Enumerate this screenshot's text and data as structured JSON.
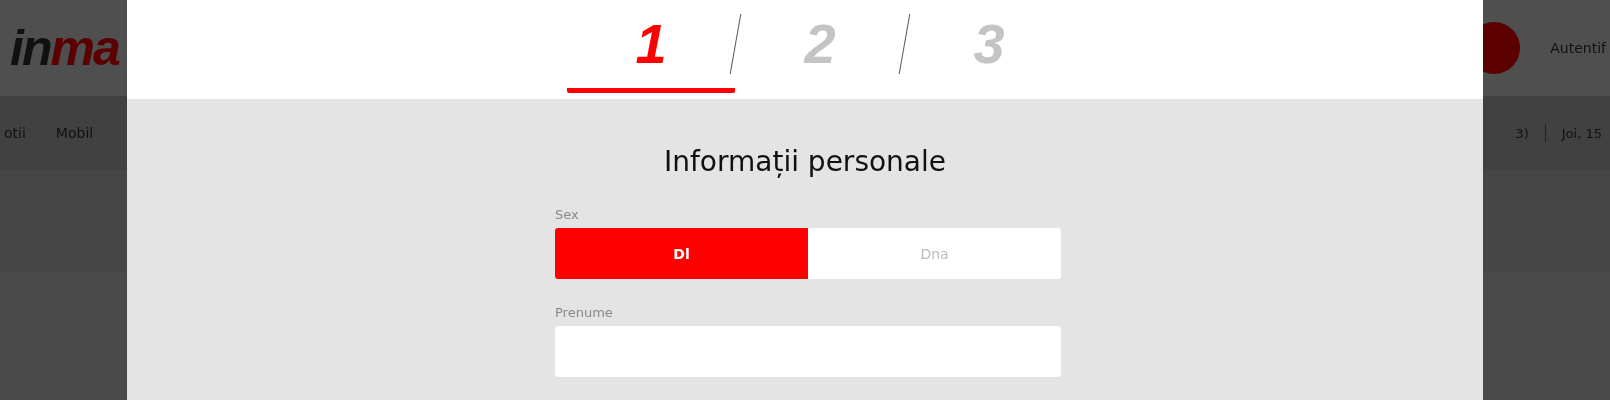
{
  "header": {
    "logo": {
      "part_1": "in",
      "part_2": "ma"
    },
    "login_link": "Autentif"
  },
  "nav": {
    "items": [
      "otii",
      "Mobil"
    ],
    "right": [
      "3)",
      "Joi, 15"
    ]
  },
  "modal": {
    "steps": [
      {
        "label": "1",
        "selected": true
      },
      {
        "label": "2",
        "selected": false
      },
      {
        "label": "3",
        "selected": false
      }
    ],
    "title": "Informații personale",
    "sex": {
      "label": "Sex",
      "options": [
        {
          "label": "Dl",
          "selected": true
        },
        {
          "label": "Dna",
          "selected": false
        }
      ]
    },
    "first_name": {
      "label": "Prenume"
    }
  }
}
